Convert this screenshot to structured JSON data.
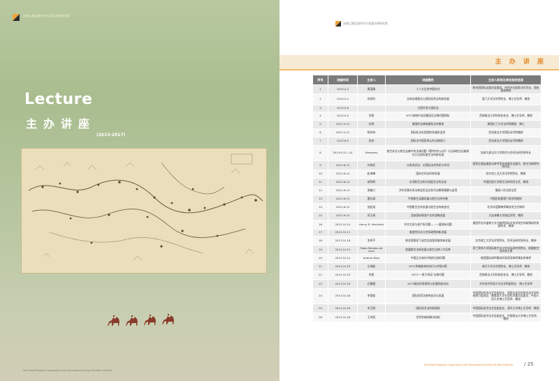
{
  "left_page": {
    "running_head": "丝绸之路区域合作与发展法律研究院",
    "title_en": "Lecture",
    "title_zh": "主办讲座",
    "years": "(2013-2017)",
    "footer": "Silk Road Regional Cooperation and Development Legal Studies Institute"
  },
  "right_page": {
    "running_head": "丝绸之路区域合作与发展法律研究院",
    "section_title": "主 办 讲 座",
    "footer": "Silk Road Regional Cooperation and Development Legal Studies Institute",
    "page_number": "/ 25",
    "accent_color": "#e3892c"
  },
  "table": {
    "headers": [
      "序号",
      "讲座时间",
      "主讲人",
      "讲座题目",
      "主讲人职务及单位相关信息"
    ],
    "rows": [
      {
        "no": "1",
        "date": "2013.4.3",
        "speaker": "黄惠康",
        "topic": "十八大后的中国外交",
        "info": "联合国国际法委员会委员、时任外交部条法司司长、我校客座教授",
        "h": 13
      },
      {
        "no": "2",
        "date": "2013.5.4",
        "speaker": "徐崇利",
        "topic": "全球治理理论与国际投资法的新发展",
        "info": "厦门大学法学院院长、博士生导师、教授",
        "h": 16
      },
      {
        "no": "3",
        "date": "2013.5.6",
        "speaker": "",
        "topic": "大国关系与国际法",
        "info": "",
        "h": 10
      },
      {
        "no": "4",
        "date": "2013.5.9",
        "speaker": "徐泉",
        "topic": "WTO体制中成员集团化法律问题探析",
        "info": "西南政法大学科研处处长、博士生导师、教授",
        "h": 12
      },
      {
        "no": "5",
        "date": "2013.5.13",
        "speaker": "杜明",
        "topic": "美国的法律制度和法学教育",
        "info": "美国杜兰大学法学院教授、博士",
        "h": 12
      },
      {
        "no": "6",
        "date": "2013.5.22",
        "speaker": "杨泽伟",
        "topic": "国际私法在我国的发展和适用",
        "info": "西北政法大学国际法学院教授",
        "h": 12
      },
      {
        "no": "7",
        "date": "2013.6.5",
        "speaker": "张杰",
        "topic": "国际法中国家承认的法律效力",
        "info": "西北政法大学国际法学院教授",
        "h": 12
      },
      {
        "no": "8",
        "date": "2013.6.13—14",
        "speaker": "Dempsey",
        "topic": "航空安全与航空运输中的法律问题《蒙特利尔公约》与全球航空运输责任立法国际航空法的新发展",
        "info": "加拿大麦吉尔大学航空与空间法研究所所长",
        "h": 22
      },
      {
        "no": "9",
        "date": "2013.6.13",
        "speaker": "刘伟民",
        "topic": "仪表测试法：论国际法的性质与作用",
        "info": "国家交通运输部法律专家咨询委员会委员、航空法律研究所所长",
        "h": 13
      },
      {
        "no": "10",
        "date": "2013.6.14",
        "speaker": "赵海峰",
        "topic": "国际空间法的新发展",
        "info": "哈尔滨工业大学法学院院长、教授",
        "h": 12
      },
      {
        "no": "11",
        "date": "2013.6.14",
        "speaker": "郝秀辉",
        "topic": "台湾航空法和大陆航空法的比较",
        "info": "中国民航大学航空法研究所主任、教授",
        "h": 12
      },
      {
        "no": "12",
        "date": "2013.6.14",
        "speaker": "高敏力",
        "topic": "涉外民事关系法律适用法及其司法解释理解与适用",
        "info": "最高人民法院法官",
        "h": 12
      },
      {
        "no": "13",
        "date": "2013.6.15",
        "speaker": "董念清",
        "topic": "中国航空运输发展与航空法的完善",
        "info": "中国民航管理干部学院教授",
        "h": 12
      },
      {
        "no": "14",
        "date": "2013.6.15",
        "speaker": "张起淮",
        "topic": "中国航空业的发展与航空法的新变化",
        "info": "北京市蓝鹏律师事务所主任律师",
        "h": 12
      },
      {
        "no": "15",
        "date": "2013.9.13",
        "speaker": "邓玉瑶",
        "topic": "西安国际物流产业的战略发展",
        "info": "大连海事大学航运学院、教授",
        "h": 12
      },
      {
        "no": "16",
        "date": "2013.10.10",
        "speaker": "Henry R. Hertzfeld",
        "topic": "外空主权与遥产权问题——一道国有问题",
        "info": "美国乔治华盛顿大学艾略特国际关系学院空间政策研究所副所长、教授",
        "h": 13
      },
      {
        "no": "17",
        "date": "2013.10.11",
        "speaker": "",
        "topic": "美国空间法与空间政策的新发展",
        "info": "",
        "h": 10
      },
      {
        "no": "18",
        "date": "2013.10.18",
        "speaker": "李寿平",
        "topic": "联合国框架下谈判及加强领域的新发展",
        "info": "北京理工大学法学院院长、空间法研究所所长、教授",
        "h": 13
      },
      {
        "no": "19",
        "date": "2013.10.21",
        "speaker": "Pablo Mendes de Leon",
        "topic": "欧盟航空法新发展与航空法律人才培养",
        "info": "荷兰莱顿大学国际航空法与空间法研究院院长、欧盟航空法协会主席",
        "h": 13
      },
      {
        "no": "20",
        "date": "2013.10.21",
        "speaker": "Andrea Ross",
        "topic": "中国企业海外并购的法律问题",
        "info": "美国国际律师事务所和资深律师事务所律师",
        "h": 12
      },
      {
        "no": "21",
        "date": "2013.10.25",
        "speaker": "左海聪",
        "topic": "WTO争端裁决的执行与中国对策",
        "info": "南开大学法学院院长、博士生导师、教授",
        "h": 12
      },
      {
        "no": "22",
        "date": "2013.10.25",
        "speaker": "徐泉",
        "topic": "WTO\"一揽子承诺\"法律问题",
        "info": "西南政法大学科研处处长、博士生导师、教授",
        "h": 12
      },
      {
        "no": "23",
        "date": "2013.10.25",
        "speaker": "石静霞",
        "topic": "WTO服务贸易规则与发展的新动向",
        "info": "对外经济贸易大学法学院副院长、博士生导师",
        "h": 13
      },
      {
        "no": "24",
        "date": "2013.10.26",
        "speaker": "李国权",
        "topic": "国际投资法制的变动与发展",
        "info": "中国国际经济法学会副会长、国家社会科学研究法学学科规划小组成员、教育部人文社会科学委员会委员、中国人民大学博士生导师、教授",
        "h": 22
      },
      {
        "no": "25",
        "date": "2013.10.26",
        "speaker": "车丕照",
        "topic": "国际经济法的新趋势",
        "info": "中国国际经济法学会副会长、清华大学博士生导师、教授",
        "h": 13
      },
      {
        "no": "26",
        "date": "2013.10.26",
        "speaker": "王传丽",
        "topic": "世贸争端的解决机制",
        "info": "中国国际经济法学会副会长、中国政法大学博士生导师、教授",
        "h": 13
      }
    ]
  }
}
